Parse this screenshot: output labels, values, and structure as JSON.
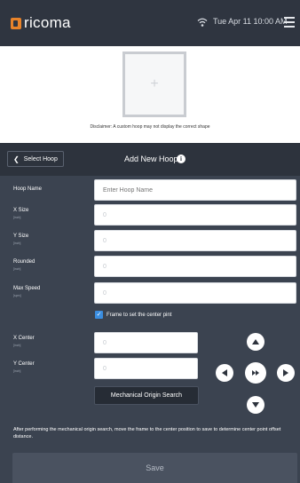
{
  "topbar": {
    "brand": "ricoma",
    "datetime": "Tue Apr 11  10:00 AM",
    "icons": [
      "wifi-icon",
      "menu-icon"
    ]
  },
  "preview": {
    "disclaimer": "Disclaimer: A custom hoop may not display the correct shape"
  },
  "header": {
    "back_label": "Select Hoop",
    "title": "Add New Hoop"
  },
  "form": {
    "hoop_name": {
      "label": "Hoop Name",
      "placeholder": "Enter Hoop Name"
    },
    "x_size": {
      "label": "X Size",
      "unit": "[inch]",
      "value": "0"
    },
    "y_size": {
      "label": "Y Size",
      "unit": "[inch]",
      "value": "0"
    },
    "rounded": {
      "label": "Rounded",
      "unit": "[inch]",
      "value": "0"
    },
    "max_speed": {
      "label": "Max Speed",
      "unit": "[spm]",
      "value": "0"
    },
    "frame_checkbox": {
      "label": "Frame to set the center pint",
      "checked": true
    },
    "x_center": {
      "label": "X Center",
      "unit": "[inch]",
      "value": "0"
    },
    "y_center": {
      "label": "Y Center",
      "unit": "[inch]",
      "value": "0"
    },
    "mech_button": "Mechanical Origin Search",
    "note": "After performing the mechanical origin search, move the frame to the center position to save to determine center point offset distance."
  },
  "footer": {
    "save_label": "Save"
  },
  "colors": {
    "brand_orange": "#e8832a",
    "topbar_bg": "#2f3540",
    "panel_bg": "#3b4350",
    "checkbox_blue": "#3a8de0"
  }
}
